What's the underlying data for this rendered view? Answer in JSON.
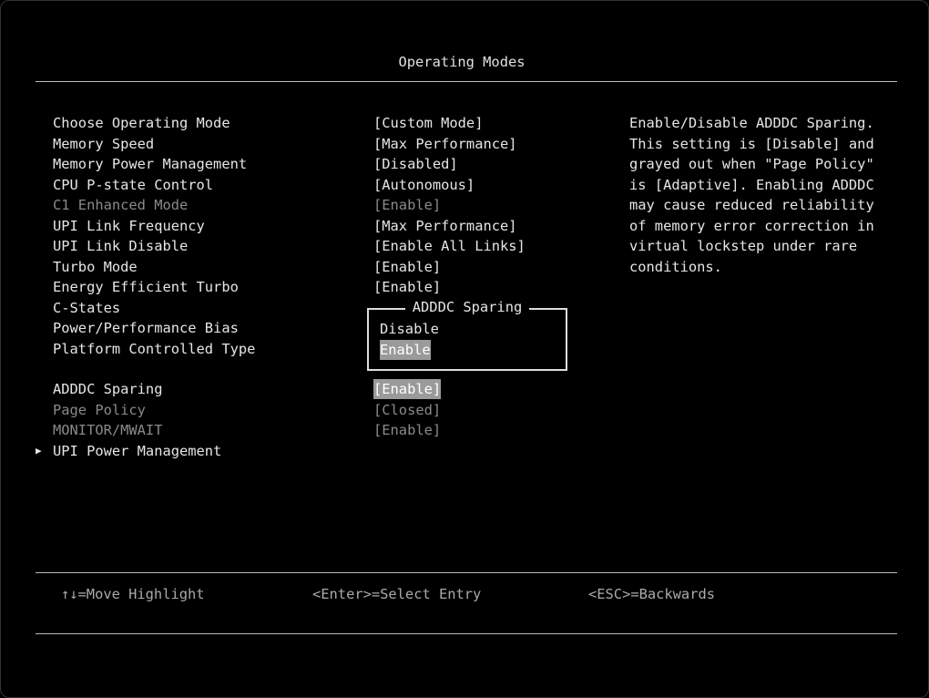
{
  "header": {
    "title": "Operating Modes"
  },
  "settings": [
    {
      "label": "Choose Operating Mode",
      "value": "[Custom Mode]",
      "disabled": false
    },
    {
      "label": "Memory Speed",
      "value": "[Max Performance]",
      "disabled": false
    },
    {
      "label": "Memory Power Management",
      "value": "[Disabled]",
      "disabled": false
    },
    {
      "label": "CPU P-state Control",
      "value": "[Autonomous]",
      "disabled": false
    },
    {
      "label": "C1 Enhanced Mode",
      "value": "[Enable]",
      "disabled": true
    },
    {
      "label": "UPI Link Frequency",
      "value": "[Max Performance]",
      "disabled": false
    },
    {
      "label": "UPI Link Disable",
      "value": "[Enable All Links]",
      "disabled": false
    },
    {
      "label": "Turbo Mode",
      "value": "[Enable]",
      "disabled": false
    },
    {
      "label": "Energy Efficient Turbo",
      "value": "[Enable]",
      "disabled": false
    },
    {
      "label": "C-States",
      "value": "",
      "disabled": false
    },
    {
      "label": "Power/Performance Bias",
      "value": "",
      "disabled": false
    },
    {
      "label": "Platform Controlled Type",
      "value": "",
      "disabled": false
    },
    {
      "label": "ADDDC Sparing",
      "value": "[Enable]",
      "disabled": false,
      "selected": true
    },
    {
      "label": "Page Policy",
      "value": "[Closed]",
      "disabled": true
    },
    {
      "label": "MONITOR/MWAIT",
      "value": "[Enable]",
      "disabled": true
    },
    {
      "label": "UPI Power Management",
      "value": "",
      "disabled": false,
      "submenu": true,
      "icon": "triangle-right-icon"
    }
  ],
  "help": "Enable/Disable ADDDC Sparing.\nThis setting is [Disable] and\ngrayed out when \"Page Policy\"\nis [Adaptive]. Enabling ADDDC\nmay cause reduced reliability\nof memory error correction in\nvirtual lockstep under rare\nconditions.",
  "popup": {
    "title": "ADDDC Sparing",
    "options": [
      "Disable",
      "Enable"
    ],
    "selected": 1
  },
  "footer": {
    "move": "↑↓=Move Highlight",
    "select": "<Enter>=Select Entry",
    "back": "<ESC>=Backwards"
  },
  "colors": {
    "highlight": "#9a9a9a",
    "disabled": "#8a8a8a",
    "text": "#e6e6e6"
  }
}
